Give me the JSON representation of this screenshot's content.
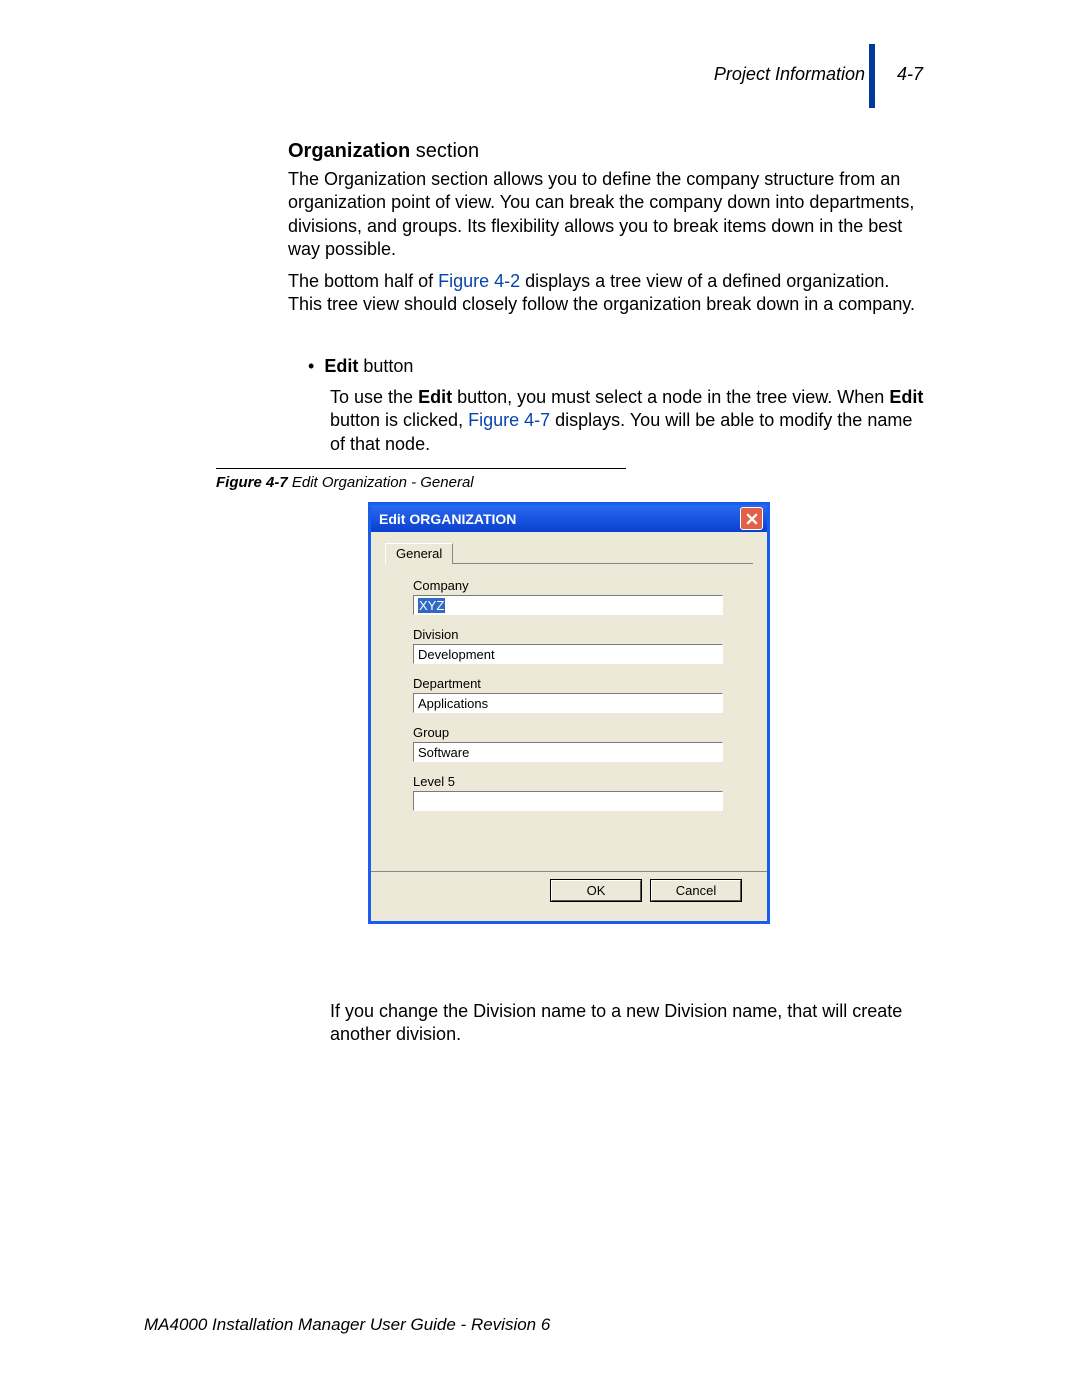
{
  "header": {
    "section_name": "Project Information",
    "page_number": "4-7"
  },
  "section": {
    "heading_bold": "Organization",
    "heading_rest": " section",
    "para1": "The Organization section allows you to define the company structure from an organization point of view. You can break the company down into departments, divisions, and groups. Its flexibility allows you to break items down in the best way possible.",
    "para2_pre": "The bottom half of ",
    "para2_link1": "Figure 4-2",
    "para2_post": " displays a tree view of a defined organization. This tree view should closely follow the organization break down in a company.",
    "bullet_label_bold": "Edit",
    "bullet_label_rest": " button",
    "para3_a": "To use the ",
    "para3_b": "Edit",
    "para3_c": " button, you must select a node in the tree view. When ",
    "para3_d": "Edit",
    "para3_e": " button is clicked, ",
    "para3_link": "Figure 4-7",
    "para3_f": " displays. You will be able to modify the name of that node.",
    "figcap_bold": "Figure 4-7",
    "figcap_rest": "  Edit Organization - General",
    "para4": "If you change the Division name to a new Division name, that will create another division."
  },
  "dialog": {
    "title": "Edit ORGANIZATION",
    "tab": "General",
    "fields": {
      "company": {
        "label": "Company",
        "value": "XYZ"
      },
      "division": {
        "label": "Division",
        "value": "Development"
      },
      "department": {
        "label": "Department",
        "value": "Applications"
      },
      "group": {
        "label": "Group",
        "value": "Software"
      },
      "level5": {
        "label": "Level 5",
        "value": ""
      }
    },
    "buttons": {
      "ok": "OK",
      "cancel": "Cancel"
    }
  },
  "footer": "MA4000 Installation Manager User Guide - Revision 6"
}
